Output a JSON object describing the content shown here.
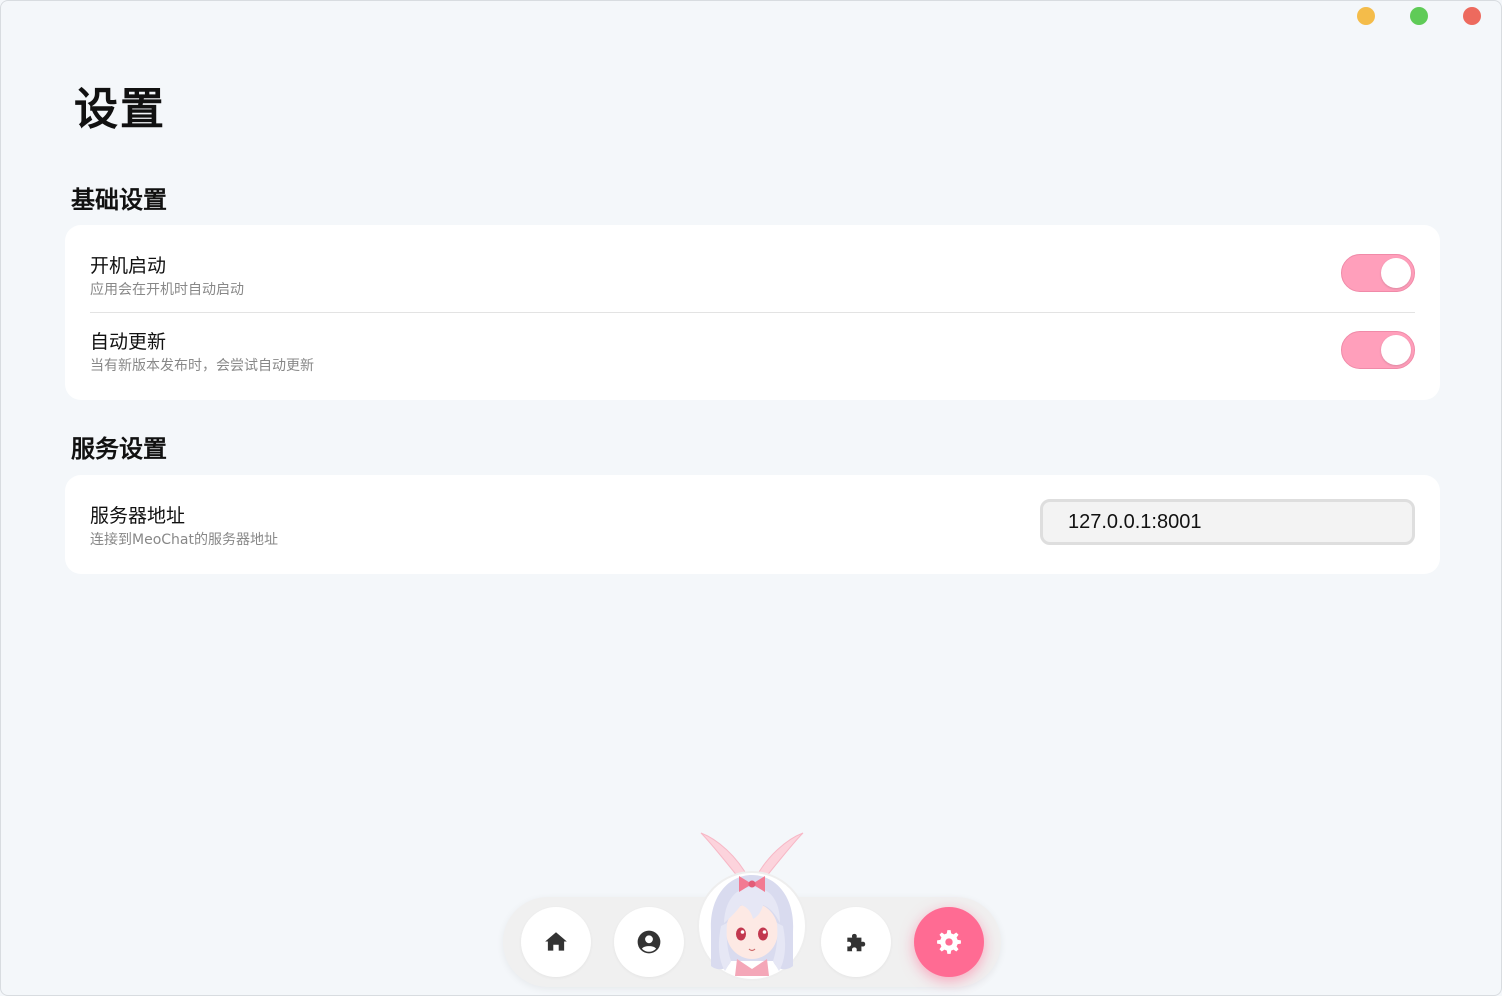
{
  "window": {
    "controls": [
      "minimize",
      "maximize",
      "close"
    ],
    "colors": {
      "minimize": "#f4bc4a",
      "maximize": "#5fcb57",
      "close": "#ed6a5e"
    }
  },
  "page": {
    "title": "设置"
  },
  "basic": {
    "section_title": "基础设置",
    "autostart": {
      "label": "开机启动",
      "desc": "应用会在开机时自动启动",
      "enabled": true
    },
    "autoupdate": {
      "label": "自动更新",
      "desc": "当有新版本发布时，会尝试自动更新",
      "enabled": true
    }
  },
  "service": {
    "section_title": "服务设置",
    "server": {
      "label": "服务器地址",
      "desc": "连接到MeoChat的服务器地址",
      "value": "127.0.0.1:8001"
    }
  },
  "nav": {
    "items": [
      {
        "name": "home",
        "icon": "home-icon"
      },
      {
        "name": "profile",
        "icon": "user-circle-icon"
      },
      {
        "name": "avatar",
        "icon": "avatar"
      },
      {
        "name": "plugins",
        "icon": "puzzle-icon"
      },
      {
        "name": "settings",
        "icon": "gear-icon",
        "active": true
      }
    ],
    "accent": "#ff6b93"
  },
  "theme": {
    "toggle_on": "#ff9fbb",
    "background": "#f4f7fa"
  }
}
